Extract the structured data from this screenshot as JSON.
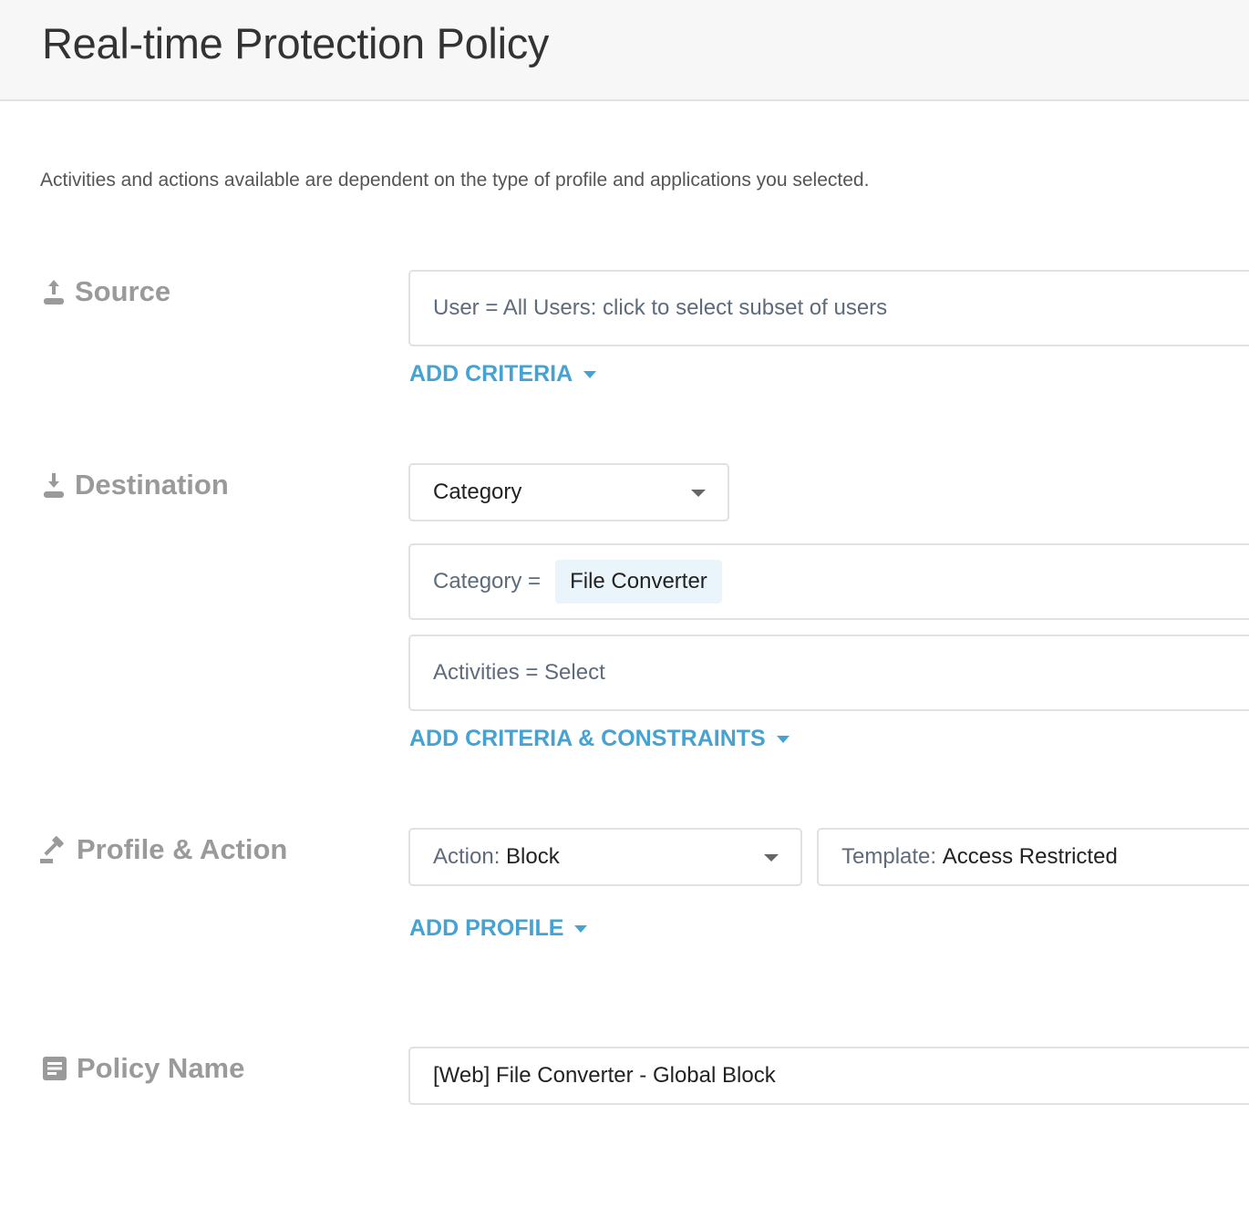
{
  "header": {
    "title": "Real-time Protection Policy"
  },
  "description": "Activities and actions available are dependent on the type of profile and applications you selected.",
  "source": {
    "label": "Source",
    "icon": "upload-icon",
    "user_field": "User = All Users: click to select subset of users",
    "add_label": "ADD CRITERIA"
  },
  "destination": {
    "label": "Destination",
    "icon": "download-icon",
    "type_select": "Category",
    "category_prefix": "Category =",
    "category_value": "File Converter",
    "activities_field": "Activities = Select",
    "add_label": "ADD CRITERIA & CONSTRAINTS"
  },
  "profile": {
    "label": "Profile & Action",
    "icon": "gavel-icon",
    "action_prefix": "Action:",
    "action_value": "Block",
    "template_prefix": "Template:",
    "template_value": "Access Restricted",
    "add_label": "ADD PROFILE"
  },
  "policy_name": {
    "label": "Policy Name",
    "icon": "document-icon",
    "value": "[Web] File Converter - Global Block"
  },
  "colors": {
    "link": "#45a2d1",
    "chip": "#eaf5fb",
    "section": "#9a9a9a"
  }
}
